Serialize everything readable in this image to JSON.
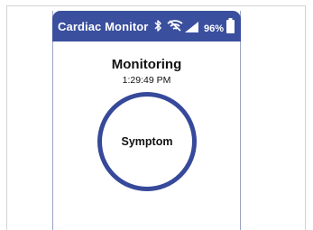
{
  "status_bar": {
    "title": "Cardiac Monitor",
    "battery_percent": "96%",
    "battery_level": 0.96,
    "icons": [
      "bluetooth-icon",
      "wifi-off-icon",
      "cell-signal-icon",
      "battery-icon"
    ]
  },
  "main": {
    "heading": "Monitoring",
    "time": "1:29:49 PM",
    "symptom_button_label": "Symptom"
  },
  "colors": {
    "header_bg": "#3a4f9e",
    "ring": "#36499a"
  }
}
